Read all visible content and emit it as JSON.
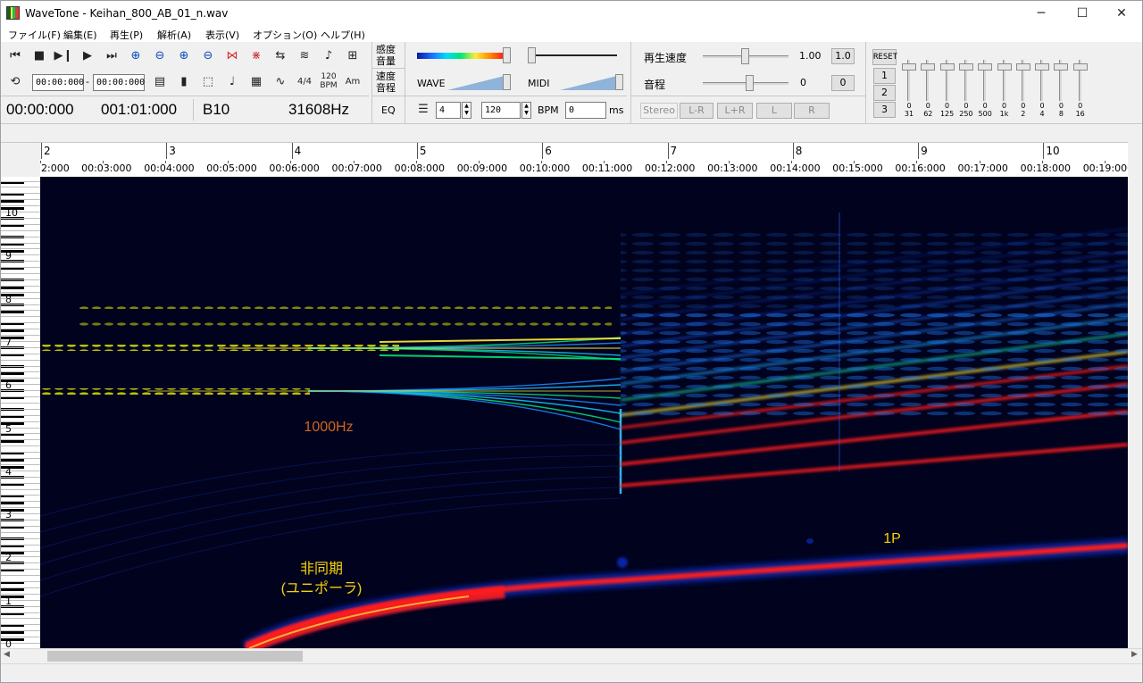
{
  "window": {
    "title": "WaveTone - Keihan_800_AB_01_n.wav",
    "minimize": "─",
    "maximize": "☐",
    "close": "✕"
  },
  "menu": [
    "ファイル(F)",
    "編集(E)",
    "再生(P)",
    "解析(A)",
    "表示(V)",
    "オプション(O)",
    "ヘルプ(H)"
  ],
  "toolbar": {
    "range_start": "00:00:000",
    "range_sep": "-",
    "range_end": "00:00:000",
    "time_sig": "4/4",
    "bpm_icon_top": "120",
    "bpm_icon_bottom": "BPM",
    "am_icon": "Am",
    "readout_time": "00:00:000",
    "readout_measure": "001:01:000",
    "readout_note": "B10",
    "readout_freq": "31608Hz",
    "sensitivity": "感度",
    "volume": "音量",
    "speed_label_top": "速度",
    "pitch_label_top": "音程",
    "wave_label": "WAVE",
    "midi_label": "MIDI",
    "eq_label": "EQ",
    "beats_value": "4",
    "bpm_value": "120",
    "bpm_unit": "BPM",
    "ms_value": "0",
    "ms_unit": "ms",
    "playback_speed_label": "再生速度",
    "playback_speed_value": "1.00",
    "playback_speed_reset": "1.0",
    "pitch_label": "音程",
    "pitch_value": "0",
    "pitch_reset": "0",
    "stereo_buttons": [
      "Stereo",
      "L-R",
      "L+R",
      "L",
      "R"
    ],
    "eq_reset": "RESET",
    "eq_presets": [
      "1",
      "2",
      "3"
    ],
    "eq_bands": [
      {
        "freq": "31",
        "value": "0"
      },
      {
        "freq": "62",
        "value": "0"
      },
      {
        "freq": "125",
        "value": "0"
      },
      {
        "freq": "250",
        "value": "0"
      },
      {
        "freq": "500",
        "value": "0"
      },
      {
        "freq": "1k",
        "value": "0"
      },
      {
        "freq": "2",
        "value": "0"
      },
      {
        "freq": "4",
        "value": "0"
      },
      {
        "freq": "8",
        "value": "0"
      },
      {
        "freq": "16",
        "value": "0"
      }
    ]
  },
  "ruler": {
    "measures": [
      "2",
      "3",
      "4",
      "5",
      "6",
      "7",
      "8",
      "9",
      "10"
    ],
    "times": [
      "2:000",
      "00:03:000",
      "00:04:000",
      "00:05:000",
      "00:06:000",
      "00:07:000",
      "00:08:000",
      "00:09:000",
      "00:10:000",
      "00:11:000",
      "00:12:000",
      "00:13:000",
      "00:14:000",
      "00:15:000",
      "00:16:000",
      "00:17:000",
      "00:18:000",
      "00:19:000"
    ]
  },
  "keyboard": {
    "octaves": [
      "10",
      "9",
      "8",
      "7",
      "6",
      "5",
      "4",
      "3",
      "2",
      "1",
      "0"
    ]
  },
  "spectrogram": {
    "annotations": {
      "freq_1000": "1000Hz",
      "async_line1": "非同期",
      "async_line2": "(ユニポーラ)",
      "one_p": "1P"
    },
    "colors": {
      "background": "#01021e",
      "low": "#0b2fc9",
      "mid": "#00e676",
      "high": "#ffeb3b",
      "peak": "#ff1a1a",
      "annotation_orange": "#d0661e",
      "annotation_yellow": "#f5d200"
    }
  },
  "scroll": {
    "left_arrow": "◀",
    "right_arrow": "▶",
    "up_arrow": "▲",
    "down_arrow": "▼"
  }
}
